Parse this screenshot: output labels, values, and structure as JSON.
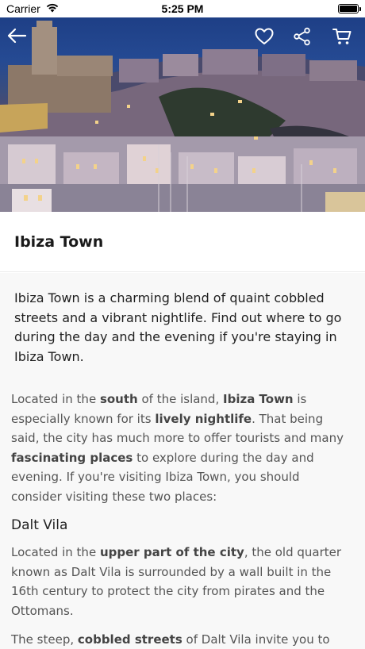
{
  "status_bar": {
    "carrier": "Carrier",
    "time": "5:25 PM",
    "battery_level": 1.0
  },
  "toolbar": {
    "back_icon": "arrow-left-icon",
    "favorite_icon": "heart-icon",
    "share_icon": "share-icon",
    "cart_icon": "cart-icon"
  },
  "title": "Ibiza Town",
  "intro": "Ibiza Town is a charming blend of quaint cobbled streets and a vibrant nightlife. Find out where to go during the day and the evening if you're staying in Ibiza Town.",
  "paragraph1": {
    "t1": "Located in the ",
    "b1": "south",
    "t2": " of the island, ",
    "b2": "Ibiza Town",
    "t3": " is especially known for its ",
    "b3": "lively nightlife",
    "t4": ". That being said, the city has much more to offer tourists and many ",
    "b4": "fascinating places",
    "t5": " to explore during the day and evening. If you're visiting Ibiza Town, you should consider visiting these two places:"
  },
  "subheading": "Dalt Vila",
  "paragraph2": {
    "t1": "Located in the ",
    "b1": "upper part of the city",
    "t2": ", the old quarter known as Dalt Vila is surrounded by a wall built in the 16th century to protect the city from pirates and the Ottomans."
  },
  "paragraph3": {
    "t1": "The steep, ",
    "b1": "cobbled streets",
    "t2": " of Dalt Vila invite you to"
  }
}
